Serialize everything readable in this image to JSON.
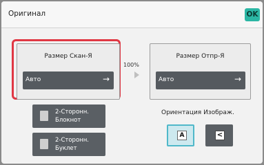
{
  "header": {
    "title": "Оригинал",
    "ok_label": "OK"
  },
  "scan_size": {
    "label": "Размер Скан-Я",
    "value": "Авто",
    "arrow": "→"
  },
  "send_size": {
    "label": "Размер Отпр-Я",
    "value": "Авто",
    "arrow": "→"
  },
  "ratio": {
    "text": "100%"
  },
  "duplex_options": [
    {
      "line1": "2-Сторонн.",
      "line2": "Блокнот",
      "icon": "booklet-icon"
    },
    {
      "line1": "2-Сторонн.",
      "line2": "Буклет",
      "icon": "tablet-icon"
    }
  ],
  "orientation": {
    "label": "Ориентация Изображ.",
    "options": [
      {
        "glyph": "A",
        "selected": true,
        "icon": "portrait-orientation-icon"
      },
      {
        "glyph": "<",
        "selected": false,
        "icon": "landscape-orientation-icon"
      }
    ]
  },
  "colors": {
    "accent": "#2bb6a4",
    "highlight": "#e03844",
    "selected_border": "#4fb8c9"
  }
}
